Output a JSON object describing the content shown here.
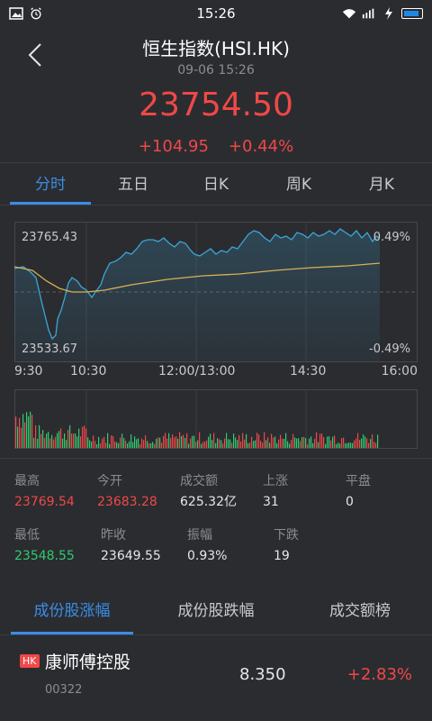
{
  "status_bar": {
    "time": "15:26",
    "left_icons": [
      "image-icon",
      "alarm-icon"
    ],
    "right_icons": [
      "wifi-icon",
      "signal-icon",
      "charging-icon",
      "battery-icon"
    ]
  },
  "header": {
    "title": "恒生指数(HSI.HK)",
    "datetime": "09-06 15:26",
    "price": "23754.50",
    "change": "+104.95",
    "change_pct": "+0.44%"
  },
  "tabs": [
    {
      "label": "分时",
      "active": true
    },
    {
      "label": "五日",
      "active": false
    },
    {
      "label": "日K",
      "active": false
    },
    {
      "label": "周K",
      "active": false
    },
    {
      "label": "月K",
      "active": false
    }
  ],
  "chart": {
    "y_top_label": "23765.43",
    "y_bottom_label": "23533.67",
    "right_top_label": "0.49%",
    "right_bottom_label": "-0.49%",
    "time_labels": [
      "9:30",
      "10:30",
      "12:00/13:00",
      "14:30",
      "16:00"
    ],
    "colors": {
      "price_line": "#3ba6d6",
      "avg_line": "#d8b054",
      "up": "#f04848",
      "down": "#2ecc71"
    }
  },
  "stats": [
    [
      {
        "label": "最高",
        "value": "23769.54",
        "color": "red"
      },
      {
        "label": "今开",
        "value": "23683.28",
        "color": "red"
      },
      {
        "label": "成交额",
        "value": "625.32亿",
        "color": "normal"
      },
      {
        "label": "上涨",
        "value": "31",
        "color": "normal"
      },
      {
        "label": "平盘",
        "value": "0",
        "color": "normal"
      }
    ],
    [
      {
        "label": "最低",
        "value": "23548.55",
        "color": "green"
      },
      {
        "label": "昨收",
        "value": "23649.55",
        "color": "normal"
      },
      {
        "label": "振幅",
        "value": "0.93%",
        "color": "normal"
      },
      {
        "label": "下跌",
        "value": "19",
        "color": "normal"
      }
    ]
  ],
  "sub_tabs": [
    {
      "label": "成份股涨幅",
      "active": true
    },
    {
      "label": "成份股跌幅",
      "active": false
    },
    {
      "label": "成交额榜",
      "active": false
    }
  ],
  "stock": {
    "badge": "HK",
    "name": "康师傅控股",
    "code": "00322",
    "price": "8.350",
    "change_pct": "+2.83%"
  }
}
